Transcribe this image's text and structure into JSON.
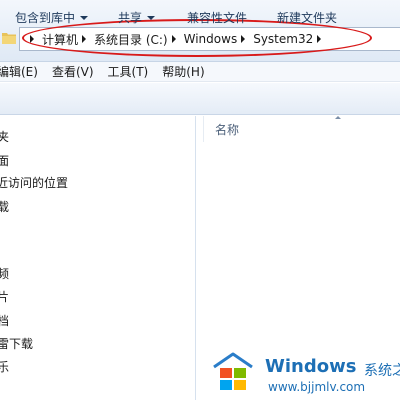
{
  "address_bar": {
    "crumbs": [
      "计算机",
      "系统目录 (C:)",
      "Windows",
      "System32"
    ],
    "annotation_color": "#d81a1a"
  },
  "menu": {
    "items": [
      "编辑(E)",
      "查看(V)",
      "工具(T)",
      "帮助(H)"
    ]
  },
  "toolbar": {
    "include_in_library": "包含到库中",
    "share": "共享",
    "compatibility_files": "兼容性文件",
    "new_folder": "新建文件夹"
  },
  "nav": {
    "items": [
      "夹",
      "面",
      "近访问的位置",
      "载",
      "",
      "",
      "频",
      "片",
      "档",
      "雷下载",
      "乐"
    ]
  },
  "content": {
    "column_name": "名称"
  },
  "watermark": {
    "brand": "Windows",
    "site_name": "系统之家",
    "url": "www.bjjmlv.com"
  }
}
